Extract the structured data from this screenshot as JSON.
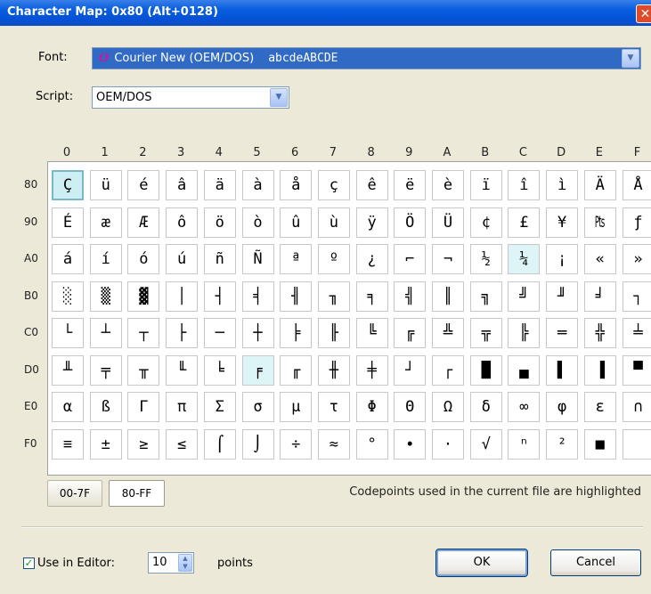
{
  "window": {
    "title": "Character Map: 0x80 (Alt+0128)"
  },
  "font": {
    "label": "Font:",
    "selected_name": "Courier New (OEM/DOS)",
    "sample": "abcdeABCDE",
    "icon": "font-type-icon"
  },
  "script": {
    "label": "Script:",
    "selected": "OEM/DOS"
  },
  "grid": {
    "column_headers": [
      "0",
      "1",
      "2",
      "3",
      "4",
      "5",
      "6",
      "7",
      "8",
      "9",
      "A",
      "B",
      "C",
      "D",
      "E",
      "F"
    ],
    "rows": [
      {
        "header": "80",
        "chars": [
          "Ç",
          "ü",
          "é",
          "â",
          "ä",
          "à",
          "å",
          "ç",
          "ê",
          "ë",
          "è",
          "ï",
          "î",
          "ì",
          "Ä",
          "Å"
        ]
      },
      {
        "header": "90",
        "chars": [
          "É",
          "æ",
          "Æ",
          "ô",
          "ö",
          "ò",
          "û",
          "ù",
          "ÿ",
          "Ö",
          "Ü",
          "¢",
          "£",
          "¥",
          "₧",
          "ƒ"
        ]
      },
      {
        "header": "A0",
        "chars": [
          "á",
          "í",
          "ó",
          "ú",
          "ñ",
          "Ñ",
          "ª",
          "º",
          "¿",
          "⌐",
          "¬",
          "½",
          "¼",
          "¡",
          "«",
          "»"
        ]
      },
      {
        "header": "B0",
        "chars": [
          "░",
          "▒",
          "▓",
          "│",
          "┤",
          "╡",
          "╢",
          "╖",
          "╕",
          "╣",
          "║",
          "╗",
          "╝",
          "╜",
          "╛",
          "┐"
        ]
      },
      {
        "header": "C0",
        "chars": [
          "└",
          "┴",
          "┬",
          "├",
          "─",
          "┼",
          "╞",
          "╟",
          "╚",
          "╔",
          "╩",
          "╦",
          "╠",
          "═",
          "╬",
          "╧"
        ]
      },
      {
        "header": "D0",
        "chars": [
          "╨",
          "╤",
          "╥",
          "╙",
          "╘",
          "╒",
          "╓",
          "╫",
          "╪",
          "┘",
          "┌",
          "█",
          "▄",
          "▌",
          "▐",
          "▀"
        ]
      },
      {
        "header": "E0",
        "chars": [
          "α",
          "ß",
          "Γ",
          "π",
          "Σ",
          "σ",
          "µ",
          "τ",
          "Φ",
          "Θ",
          "Ω",
          "δ",
          "∞",
          "φ",
          "ε",
          "∩"
        ]
      },
      {
        "header": "F0",
        "chars": [
          "≡",
          "±",
          "≥",
          "≤",
          "⌠",
          "⌡",
          "÷",
          "≈",
          "°",
          "∙",
          "·",
          "√",
          "ⁿ",
          "²",
          "■",
          " "
        ]
      }
    ],
    "selected_cell": "80",
    "highlighted_cells": [
      "AC",
      "D5"
    ]
  },
  "range_buttons": {
    "low": "00-7F",
    "high": "80-FF",
    "active": "80-FF"
  },
  "hint": "Codepoints used in the current file are highlighted",
  "editor": {
    "checkbox_label": "Use in Editor:",
    "checked": true,
    "points_value": "10",
    "points_label": "points"
  },
  "buttons": {
    "ok": "OK",
    "cancel": "Cancel"
  },
  "colors": {
    "titlebar": "#0553d6",
    "selection": "#316ac5",
    "highlight": "#ddf5f7"
  }
}
